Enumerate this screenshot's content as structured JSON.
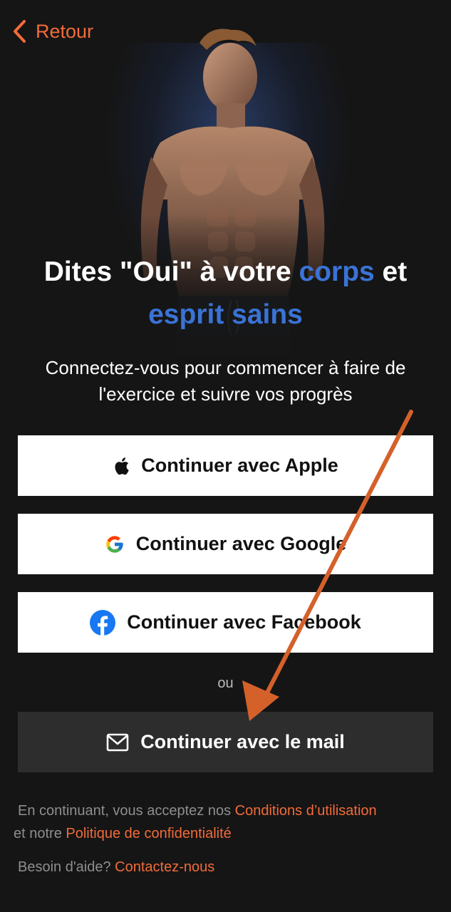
{
  "nav": {
    "back_label": "Retour"
  },
  "headline": {
    "part1": "Dites \"Oui\" à votre ",
    "accent1": "corps",
    "part2": " et",
    "accent2": "esprit sains"
  },
  "subtitle": "Connectez-vous pour commencer à faire de l'exercice et suivre vos progrès",
  "buttons": {
    "apple": "Continuer avec Apple",
    "google": "Continuer avec Google",
    "facebook": "Continuer avec Facebook",
    "mail": "Continuer avec le mail"
  },
  "or_label": "ou",
  "legal": {
    "prefix": "En continuant, vous acceptez nos ",
    "terms_link": "Conditions d’utilisation",
    "middle": " et notre ",
    "privacy_link": "Politique de confidentialité"
  },
  "help": {
    "prefix": "Besoin d'aide? ",
    "contact_link": "Contactez-nous"
  },
  "colors": {
    "accent_orange": "#f26b3a",
    "accent_blue": "#3a73d6",
    "background": "#151515",
    "mail_button": "#2d2d2d"
  },
  "icons": {
    "back": "chevron-left-icon",
    "apple": "apple-logo-icon",
    "google": "google-logo-icon",
    "facebook": "facebook-logo-icon",
    "mail": "envelope-icon"
  }
}
